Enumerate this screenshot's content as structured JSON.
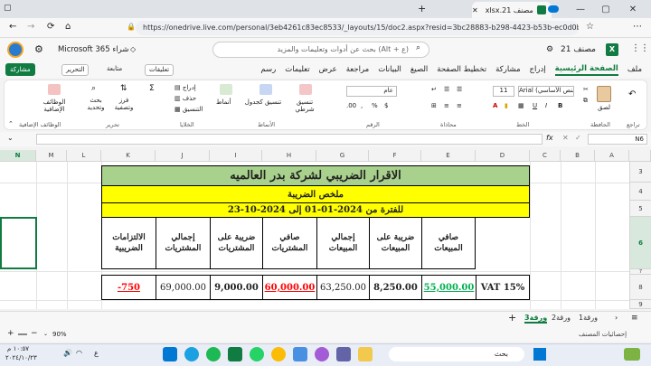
{
  "browser": {
    "tab_title": "مصنف xlsx.21",
    "url": "https://onedrive.live.com/personal/3eb4261c83ec8533/_layouts/15/doc2.aspx?resid=3bc28883-b298-4423-b53b-ec0d0b1050c7&cid=3e..."
  },
  "app": {
    "brand": "Microsoft 365 شراء",
    "doc_name": "مصنف 21",
    "search_placeholder": "بحث عن أدوات وتعليمات والمزيد (Alt + ع)"
  },
  "menu": {
    "items": [
      "ملف",
      "الصفحة الرئيسية",
      "إدراج",
      "مشاركة",
      "تخطيط الصفحة",
      "الصيغ",
      "البيانات",
      "مراجعة",
      "عرض",
      "تعليمات",
      "رسم"
    ],
    "active": "الصفحة الرئيسية"
  },
  "toolbar": {
    "share": "مشاركة",
    "edit": "التحرير",
    "follow": "متابعة",
    "comments": "تعليقات"
  },
  "ribbon": {
    "paste": "لصق",
    "clipboard": "الحافظة",
    "undo": "تراجع",
    "font_name": "Arial (النص الأساسي)",
    "font_size": "11",
    "font_group": "الخط",
    "align_group": "محاذاة",
    "number_format": "عام",
    "number_group": "الرقم",
    "cond_format": "تنسيق شرطي",
    "table_format": "تنسيق كجدول",
    "styles": "أنماط",
    "styles_group": "الأنماط",
    "insert": "إدراج",
    "delete": "حذف",
    "format": "التنسيق",
    "cells_group": "الخلايا",
    "sort": "فرز وتصفية",
    "find": "بحث وتحديد",
    "edit_group": "تحرير",
    "addins": "الوظائف الإضافية",
    "addins_group": "الوظائف الإضافية"
  },
  "formula_bar": {
    "name_box": "N6",
    "fx": "fx"
  },
  "columns": [
    "C",
    "D",
    "E",
    "F",
    "G",
    "H",
    "I",
    "J",
    "K",
    "L",
    "M",
    "N"
  ],
  "row_numbers": [
    "3",
    "4",
    "5",
    "6",
    "7",
    "8",
    "9"
  ],
  "report": {
    "title": "الاقرار الضريبي لشركة بدر العالميه",
    "subtitle": "ملخص الضريبة",
    "period": "للفترة من 2024-01-01 إلى 2024-10-23",
    "headers": [
      "صافي المبيعات",
      "ضريبة على المبيعات",
      "إجمالي المبيعات",
      "صافي المشتريات",
      "ضريبة على المشتريات",
      "إجمالي المشتريات",
      "الالتزامات الضريبية"
    ],
    "row_label": "VAT 15%",
    "values": [
      "55,000.00",
      "8,250.00",
      "63,250.00",
      "60,000.00",
      "9,000.00",
      "69,000.00",
      "-750"
    ]
  },
  "sheet_tabs": [
    "ورقة1",
    "ورقة2",
    "ورقة3"
  ],
  "active_sheet": "ورقة3",
  "status": {
    "stats": "إحصائيات المصنف",
    "zoom": "90%"
  },
  "taskbar": {
    "search": "بحث",
    "time": "١٠:٥٧ م",
    "date": "٢٠٢٤/١٠/٢٣",
    "lang": "ع"
  },
  "colors": {
    "title_fill": "#a9d18e",
    "yellow_fill": "#ffff00",
    "accent": "#107c41",
    "red_value": "#ff0000",
    "green_value": "#00b050"
  }
}
